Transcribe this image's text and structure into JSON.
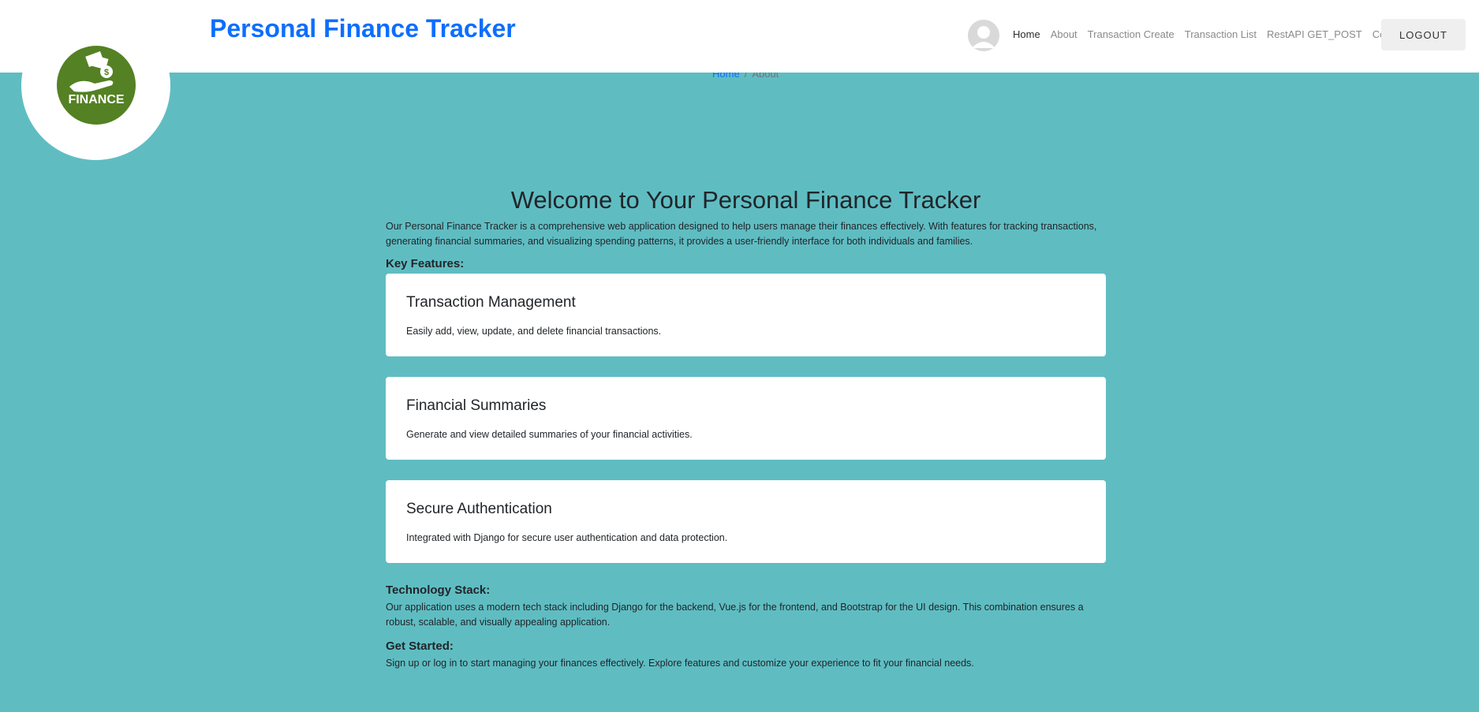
{
  "header": {
    "brand": "Personal Finance Tracker",
    "nav": [
      "Home",
      "About",
      "Transaction Create",
      "Transaction List",
      "RestAPI GET_POST",
      "Contact"
    ],
    "active_nav": "Home",
    "logout_label": "LOGOUT"
  },
  "logo": {
    "text": "FINANCE",
    "color": "#548123"
  },
  "breadcrumb": {
    "home": "Home",
    "separator": "/",
    "current": "About"
  },
  "main": {
    "title": "Welcome to Your Personal Finance Tracker",
    "intro": "Our Personal Finance Tracker is a comprehensive web application designed to help users manage their finances effectively. With features for tracking transactions, generating financial summaries, and visualizing spending patterns, it provides a user-friendly interface for both individuals and families.",
    "key_features_heading": "Key Features:",
    "features": [
      {
        "title": "Transaction Management",
        "text": "Easily add, view, update, and delete financial transactions."
      },
      {
        "title": "Financial Summaries",
        "text": "Generate and view detailed summaries of your financial activities."
      },
      {
        "title": "Secure Authentication",
        "text": "Integrated with Django for secure user authentication and data protection."
      }
    ],
    "tech_heading": "Technology Stack:",
    "tech_text": "Our application uses a modern tech stack including Django for the backend, Vue.js for the frontend, and Bootstrap for the UI design. This combination ensures a robust, scalable, and visually appealing application.",
    "started_heading": "Get Started:",
    "started_text": "Sign up or log in to start managing your finances effectively. Explore features and customize your experience to fit your financial needs."
  },
  "colors": {
    "background": "#5fbdc2",
    "brand": "#0d6efd",
    "card": "#ffffff"
  },
  "icons": {
    "avatar": "user-avatar-icon",
    "logo": "money-hand-icon"
  }
}
